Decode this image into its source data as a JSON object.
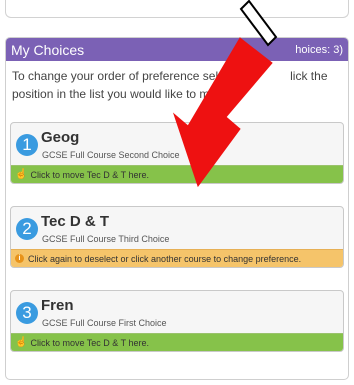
{
  "panel": {
    "title": "My Choices",
    "count": "hoices: 3)",
    "instructions_1": "To change your order of preference select",
    "instructions_1b": "lick the",
    "instructions_2": "position in the list you would like to mo"
  },
  "choices": [
    {
      "number": "1",
      "course": "Geog",
      "detail": "GCSE Full Course Second Choice",
      "footer": "Click to move Tec D & T here.",
      "footer_type": "move"
    },
    {
      "number": "2",
      "course": "Tec D & T",
      "detail": "GCSE Full Course Third Choice",
      "footer": "Click again to deselect or click another course to change preference.",
      "footer_type": "info"
    },
    {
      "number": "3",
      "course": "Fren",
      "detail": "GCSE Full Course First Choice",
      "footer": "Click to move Tec D & T here.",
      "footer_type": "move"
    }
  ],
  "icons": {
    "hand": "hand-pointer-icon",
    "info": "info-icon"
  },
  "colors": {
    "header": "#7b61b5",
    "number_circle": "#3a9be0",
    "footer_green": "#86c24a",
    "footer_orange": "#f5c46a",
    "arrow": "#ee1111"
  }
}
